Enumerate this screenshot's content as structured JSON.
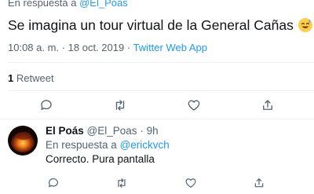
{
  "main_tweet": {
    "reply_to_prefix": "En respuesta a",
    "reply_to_handle": "@El_Poas",
    "text": "Se imagina un tour virtual de la General Cañas",
    "emoji_icon": "sweat-smile-emoji",
    "time": "10:08 a. m.",
    "separator": "·",
    "date": "18 oct. 2019",
    "app": "Twitter Web App",
    "retweet_count": "1",
    "retweet_label": "Retweet"
  },
  "reply_tweet": {
    "display_name": "El Poás",
    "handle": "@El_Poas",
    "dot": "·",
    "age": "9h",
    "reply_to_prefix": "En respuesta a",
    "reply_to_handle": "@erickvch",
    "text": "Correcto. Pura pantalla"
  },
  "icons": [
    "reply-icon",
    "retweet-icon",
    "like-icon",
    "share-icon"
  ],
  "colors": {
    "text": "#0f1419",
    "secondary": "#536471",
    "link": "#1d9bf0",
    "divider": "#eff3f4"
  }
}
